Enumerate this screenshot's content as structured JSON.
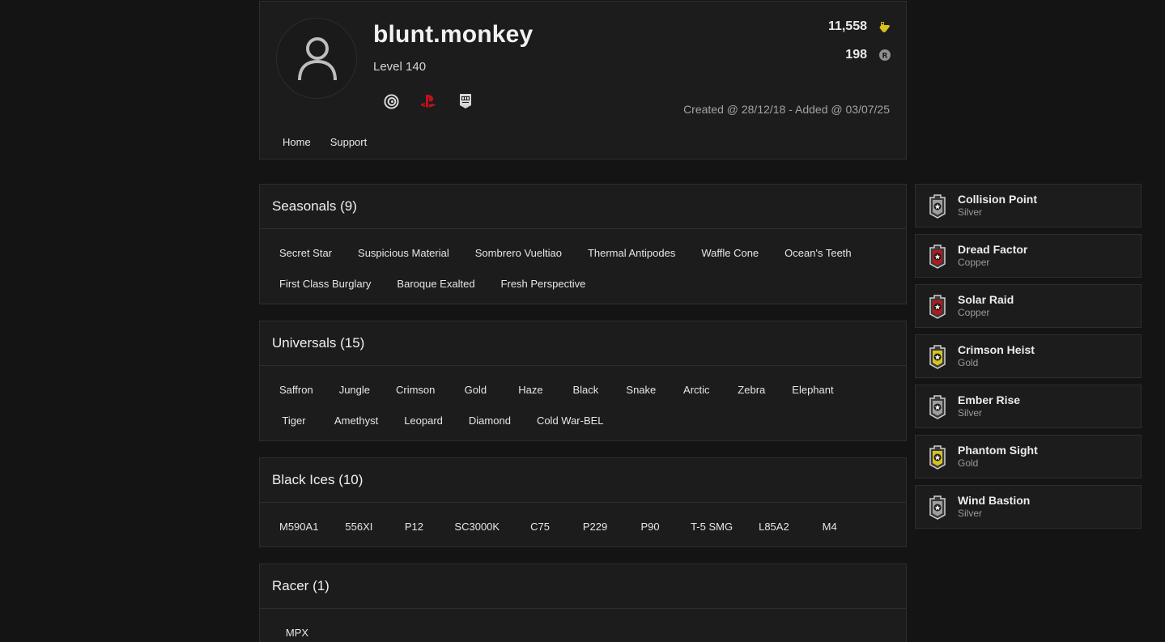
{
  "profile": {
    "username": "blunt.monkey",
    "level": "Level 140",
    "credits": "11,558",
    "renown": "198",
    "created": "Created @ 28/12/18 - Added @ 03/07/25",
    "platforms": [
      "ubisoft-icon",
      "playstation-icon",
      "epic-games-icon"
    ]
  },
  "nav": {
    "home": "Home",
    "support": "Support"
  },
  "sections": [
    {
      "title": "Seasonals (9)",
      "items": [
        "Secret Star",
        "Suspicious Material",
        "Sombrero Vueltiao",
        "Thermal Antipodes",
        "Waffle Cone",
        "Ocean's Teeth",
        "First Class Burglary",
        "Baroque Exalted",
        "Fresh Perspective"
      ]
    },
    {
      "title": "Universals (15)",
      "items": [
        "Saffron",
        "Jungle",
        "Crimson",
        "Gold",
        "Haze",
        "Black",
        "Snake",
        "Arctic",
        "Zebra",
        "Elephant",
        "Tiger",
        "Amethyst",
        "Leopard",
        "Diamond",
        "Cold War-BEL"
      ]
    },
    {
      "title": "Black Ices (10)",
      "items": [
        "M590A1",
        "556XI",
        "P12",
        "SC3000K",
        "C75",
        "P229",
        "P90",
        "T-5 SMG",
        "L85A2",
        "M4"
      ]
    },
    {
      "title": "Racer (1)",
      "items": [
        "MPX"
      ]
    }
  ],
  "charms": [
    {
      "name": "Collision Point",
      "tier": "Silver",
      "color": "#9e9e9e"
    },
    {
      "name": "Dread Factor",
      "tier": "Copper",
      "color": "#b3191f"
    },
    {
      "name": "Solar Raid",
      "tier": "Copper",
      "color": "#b3191f"
    },
    {
      "name": "Crimson Heist",
      "tier": "Gold",
      "color": "#d8c21e"
    },
    {
      "name": "Ember Rise",
      "tier": "Silver",
      "color": "#9e9e9e"
    },
    {
      "name": "Phantom Sight",
      "tier": "Gold",
      "color": "#d8c21e"
    },
    {
      "name": "Wind Bastion",
      "tier": "Silver",
      "color": "#9e9e9e"
    }
  ],
  "colors": {
    "background": "#141414",
    "panel": "#1c1c1c",
    "border": "#2e2e2e",
    "credits_icon": "#d8c21e",
    "playstation": "#c0121a"
  }
}
